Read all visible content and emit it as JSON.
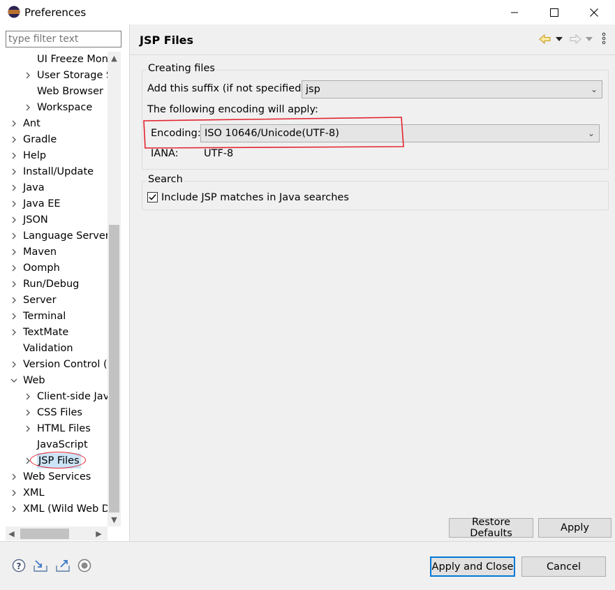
{
  "window": {
    "title": "Preferences",
    "app_icon": "eclipse-icon",
    "controls": [
      "minimize-icon",
      "maximize-icon",
      "close-icon"
    ]
  },
  "filter": {
    "placeholder": "type filter text"
  },
  "tree": {
    "items": [
      {
        "label": "UI Freeze Mon",
        "indent": 2,
        "expander": "none"
      },
      {
        "label": "User Storage S",
        "indent": 2,
        "expander": "collapsed"
      },
      {
        "label": "Web Browser",
        "indent": 2,
        "expander": "none"
      },
      {
        "label": "Workspace",
        "indent": 2,
        "expander": "collapsed"
      },
      {
        "label": "Ant",
        "indent": 1,
        "expander": "collapsed"
      },
      {
        "label": "Gradle",
        "indent": 1,
        "expander": "collapsed"
      },
      {
        "label": "Help",
        "indent": 1,
        "expander": "collapsed"
      },
      {
        "label": "Install/Update",
        "indent": 1,
        "expander": "collapsed"
      },
      {
        "label": "Java",
        "indent": 1,
        "expander": "collapsed"
      },
      {
        "label": "Java EE",
        "indent": 1,
        "expander": "collapsed"
      },
      {
        "label": "JSON",
        "indent": 1,
        "expander": "collapsed"
      },
      {
        "label": "Language Servers",
        "indent": 1,
        "expander": "collapsed"
      },
      {
        "label": "Maven",
        "indent": 1,
        "expander": "collapsed"
      },
      {
        "label": "Oomph",
        "indent": 1,
        "expander": "collapsed"
      },
      {
        "label": "Run/Debug",
        "indent": 1,
        "expander": "collapsed"
      },
      {
        "label": "Server",
        "indent": 1,
        "expander": "collapsed"
      },
      {
        "label": "Terminal",
        "indent": 1,
        "expander": "collapsed"
      },
      {
        "label": "TextMate",
        "indent": 1,
        "expander": "collapsed"
      },
      {
        "label": "Validation",
        "indent": 1,
        "expander": "none"
      },
      {
        "label": "Version Control (",
        "indent": 1,
        "expander": "collapsed"
      },
      {
        "label": "Web",
        "indent": 1,
        "expander": "expanded"
      },
      {
        "label": "Client-side Java",
        "indent": 2,
        "expander": "collapsed"
      },
      {
        "label": "CSS Files",
        "indent": 2,
        "expander": "collapsed"
      },
      {
        "label": "HTML Files",
        "indent": 2,
        "expander": "collapsed"
      },
      {
        "label": "JavaScript",
        "indent": 2,
        "expander": "none"
      },
      {
        "label": "JSP Files",
        "indent": 2,
        "expander": "collapsed",
        "selected": true
      },
      {
        "label": "Web Services",
        "indent": 1,
        "expander": "collapsed"
      },
      {
        "label": "XML",
        "indent": 1,
        "expander": "collapsed"
      },
      {
        "label": "XML (Wild Web D",
        "indent": 1,
        "expander": "collapsed"
      }
    ]
  },
  "page": {
    "title": "JSP Files",
    "nav_icons": [
      "back-arrow-icon",
      "back-menu-icon",
      "forward-arrow-icon",
      "forward-menu-icon",
      "view-menu-icon"
    ]
  },
  "creating_files": {
    "group_title": "Creating files",
    "suffix_label": "Add this suffix (if not specified):",
    "suffix_value": "jsp",
    "encoding_note": "The following encoding will apply:",
    "encoding_label": "Encoding:",
    "encoding_value": "ISO 10646/Unicode(UTF-8)",
    "iana_label": "IANA:",
    "iana_value": "UTF-8"
  },
  "search": {
    "group_title": "Search",
    "include_label": "Include JSP matches in Java searches",
    "include_checked": true
  },
  "buttons": {
    "restore_defaults": "Restore Defaults",
    "apply": "Apply",
    "apply_and_close": "Apply and Close",
    "cancel": "Cancel"
  },
  "bottom_icons": [
    "help-icon",
    "import-icon",
    "export-icon",
    "record-icon"
  ],
  "colors": {
    "selection": "#cce4f7",
    "annotation": "#e3222e",
    "default_button_border": "#0078d7",
    "panel_bg": "#f0f0f0"
  }
}
